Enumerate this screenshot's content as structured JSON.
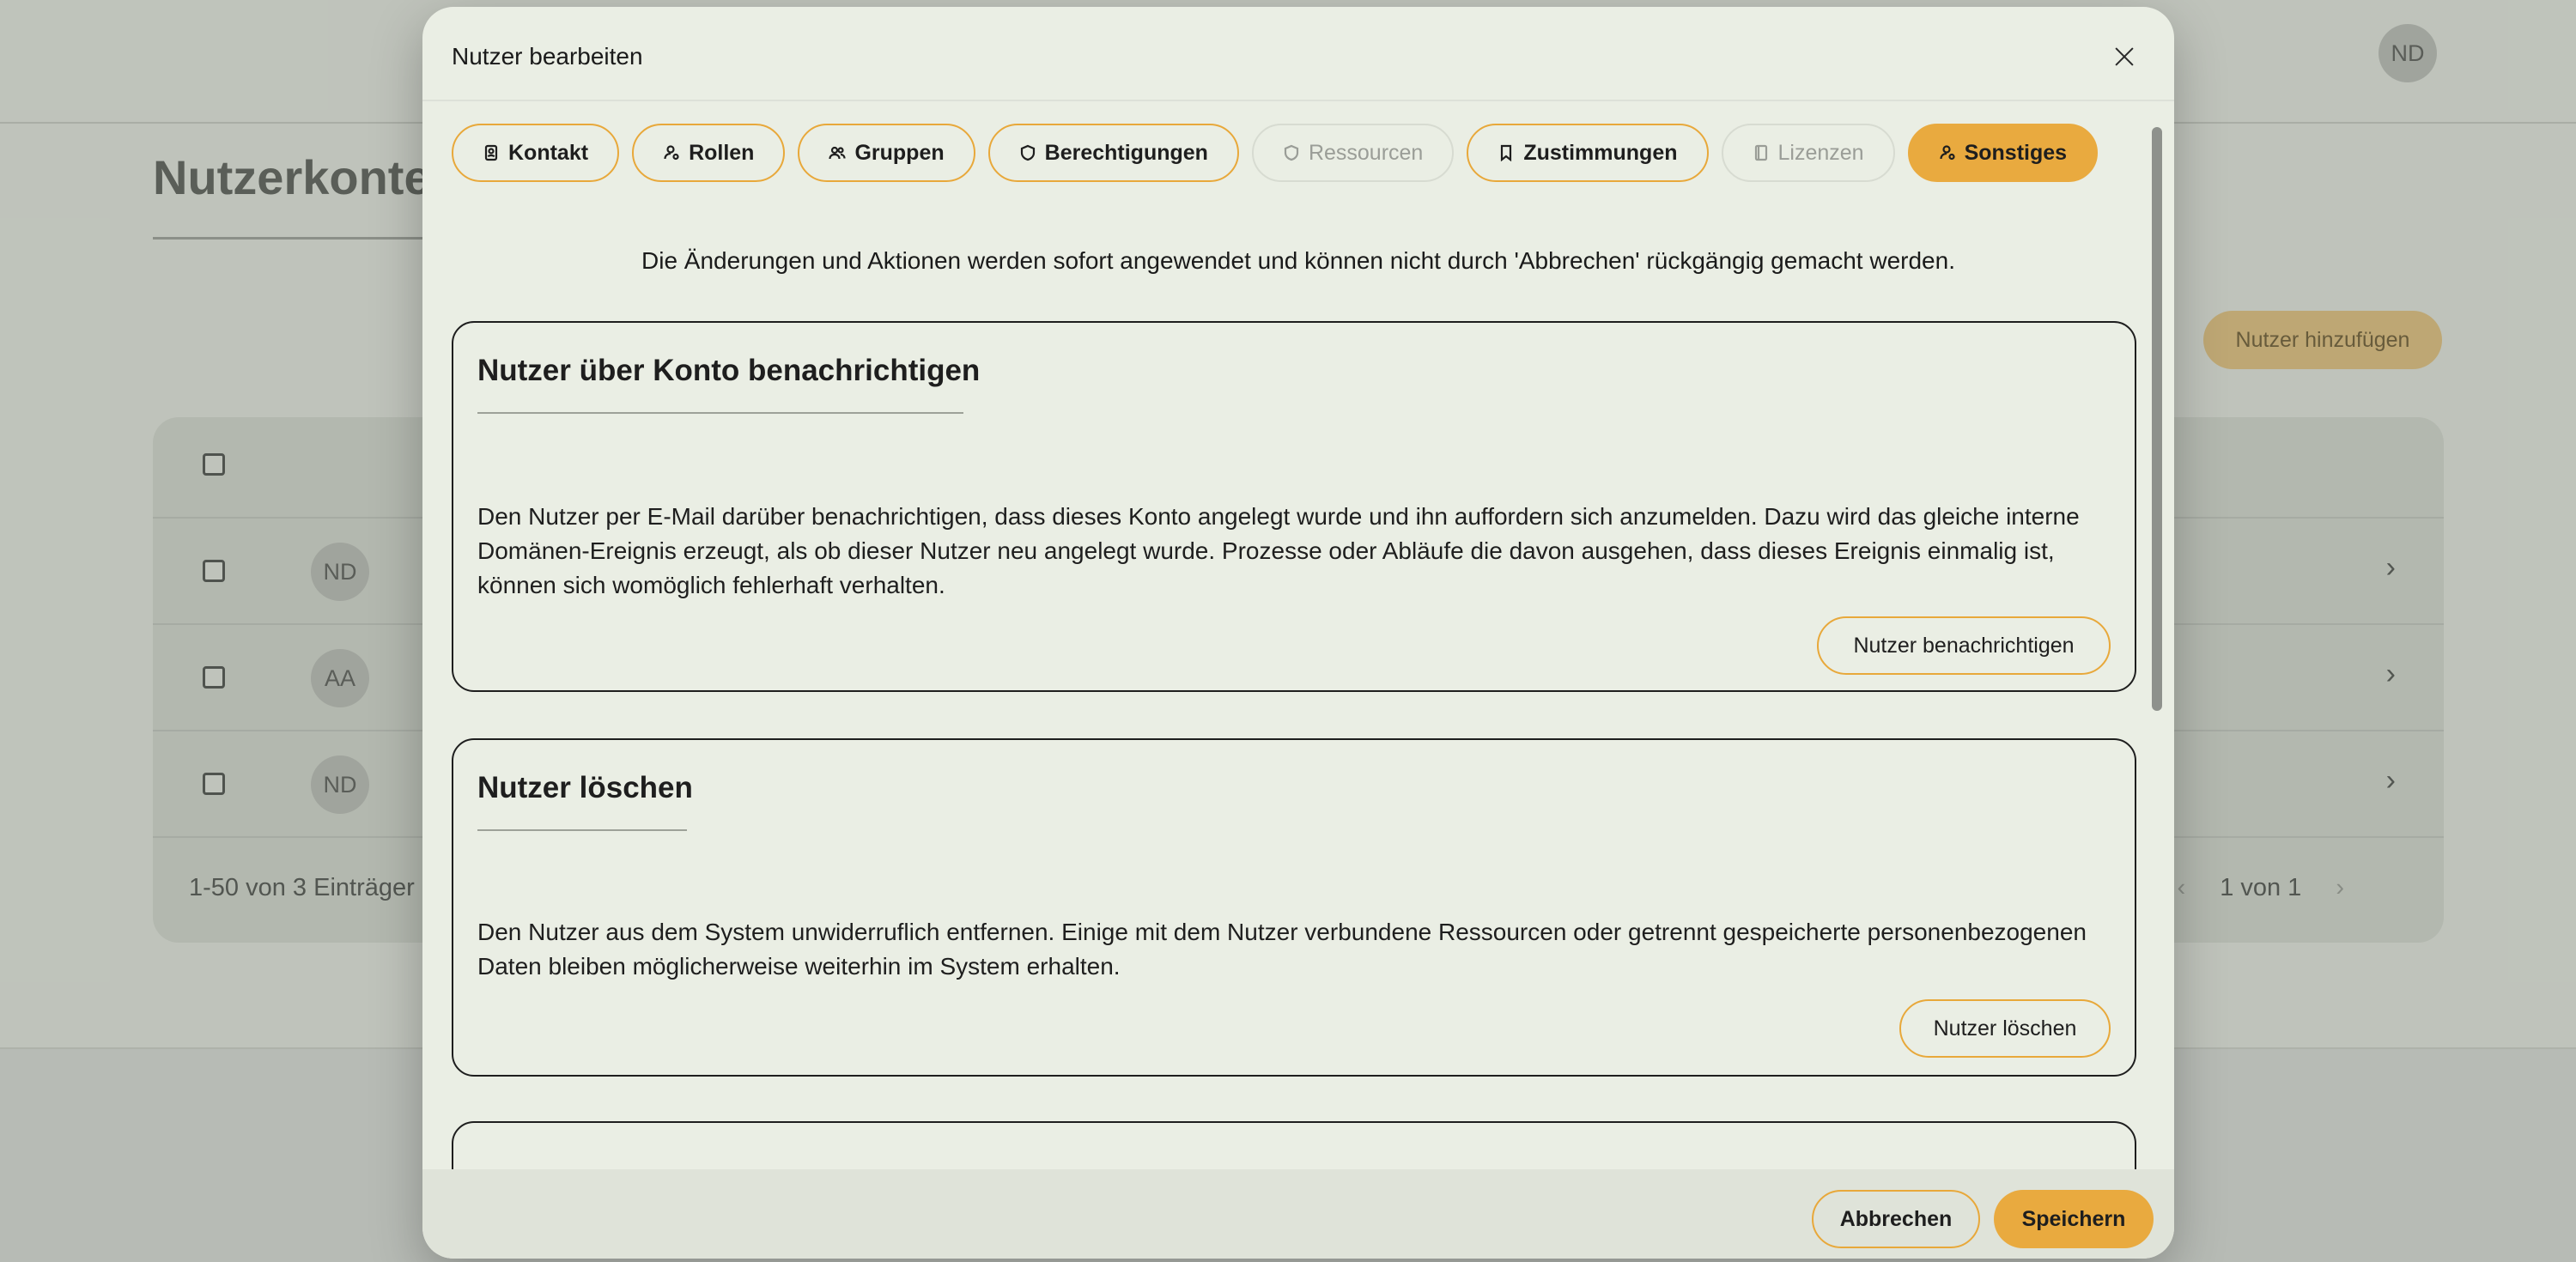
{
  "background": {
    "header_avatar": "ND",
    "page_title": "Nutzerkonte",
    "add_button": "Nutzer hinzufügen",
    "rows": [
      {
        "avatar": "ND"
      },
      {
        "avatar": "AA"
      },
      {
        "avatar": "ND"
      }
    ],
    "footer_count": "1-50 von 3 Einträger",
    "pager": "1 von 1"
  },
  "modal": {
    "title": "Nutzer bearbeiten",
    "tabs": [
      {
        "label": "Kontakt",
        "icon": "contact-icon",
        "state": "normal"
      },
      {
        "label": "Rollen",
        "icon": "user-role-icon",
        "state": "normal"
      },
      {
        "label": "Gruppen",
        "icon": "users-icon",
        "state": "normal"
      },
      {
        "label": "Berechtigungen",
        "icon": "shield-icon",
        "state": "normal"
      },
      {
        "label": "Ressourcen",
        "icon": "shield-icon",
        "state": "disabled"
      },
      {
        "label": "Zustimmungen",
        "icon": "bookmark-icon",
        "state": "normal"
      },
      {
        "label": "Lizenzen",
        "icon": "book-icon",
        "state": "disabled"
      },
      {
        "label": "Sonstiges",
        "icon": "user-cog-icon",
        "state": "active"
      }
    ],
    "notice": "Die Änderungen und Aktionen werden sofort angewendet und können nicht durch 'Abbrechen' rückgängig gemacht werden.",
    "cards": [
      {
        "title": "Nutzer über Konto benachrichtigen",
        "text": "Den Nutzer per E-Mail darüber benachrichtigen, dass dieses Konto angelegt wurde und ihn auffordern sich anzumelden. Dazu wird das gleiche interne Domänen-Ereignis erzeugt, als ob dieser Nutzer neu angelegt wurde. Prozesse oder Abläufe die davon ausgehen, dass dieses Ereignis einmalig ist, können sich womöglich fehlerhaft verhalten.",
        "button": "Nutzer benachrichtigen"
      },
      {
        "title": "Nutzer löschen",
        "text": "Den Nutzer aus dem System unwiderruflich entfernen. Einige mit dem Nutzer verbundene Ressourcen oder getrennt gespeicherte personenbezogenen Daten bleiben möglicherweise weiterhin im System erhalten.",
        "button": "Nutzer löschen"
      }
    ],
    "cancel_label": "Abbrechen",
    "save_label": "Speichern"
  },
  "colors": {
    "accent": "#e9aa3f",
    "background": "#e6ebe1",
    "modal": "#eaeee4"
  }
}
